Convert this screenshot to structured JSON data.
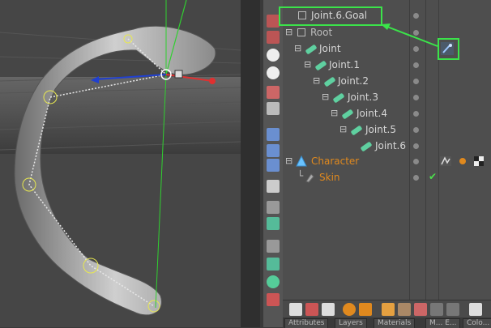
{
  "tree": {
    "items": [
      {
        "label": "Joint.6.Goal"
      },
      {
        "label": "Root"
      },
      {
        "label": "Joint"
      },
      {
        "label": "Joint.1"
      },
      {
        "label": "Joint.2"
      },
      {
        "label": "Joint.3"
      },
      {
        "label": "Joint.4"
      },
      {
        "label": "Joint.5"
      },
      {
        "label": "Joint.6"
      },
      {
        "label": "Character"
      },
      {
        "label": "Skin"
      }
    ]
  },
  "tabs": [
    "Attributes",
    "Layers",
    "Materials",
    "M... E...",
    "Colo..."
  ],
  "colors": {
    "highlight": "#3be34a",
    "orange_label": "#e0891e",
    "joint_icon": "#5fd0a0",
    "x_axis": "#e03030",
    "y_axis": "#30d030",
    "z_axis": "#2040d0"
  },
  "icons": {
    "goal": "null-goal-icon",
    "root": "null-root-icon",
    "joint": "joint-icon",
    "character": "character-icon",
    "skin": "skin-icon",
    "check": "checkmark-icon",
    "ik_tag": "ik-tag-icon"
  }
}
